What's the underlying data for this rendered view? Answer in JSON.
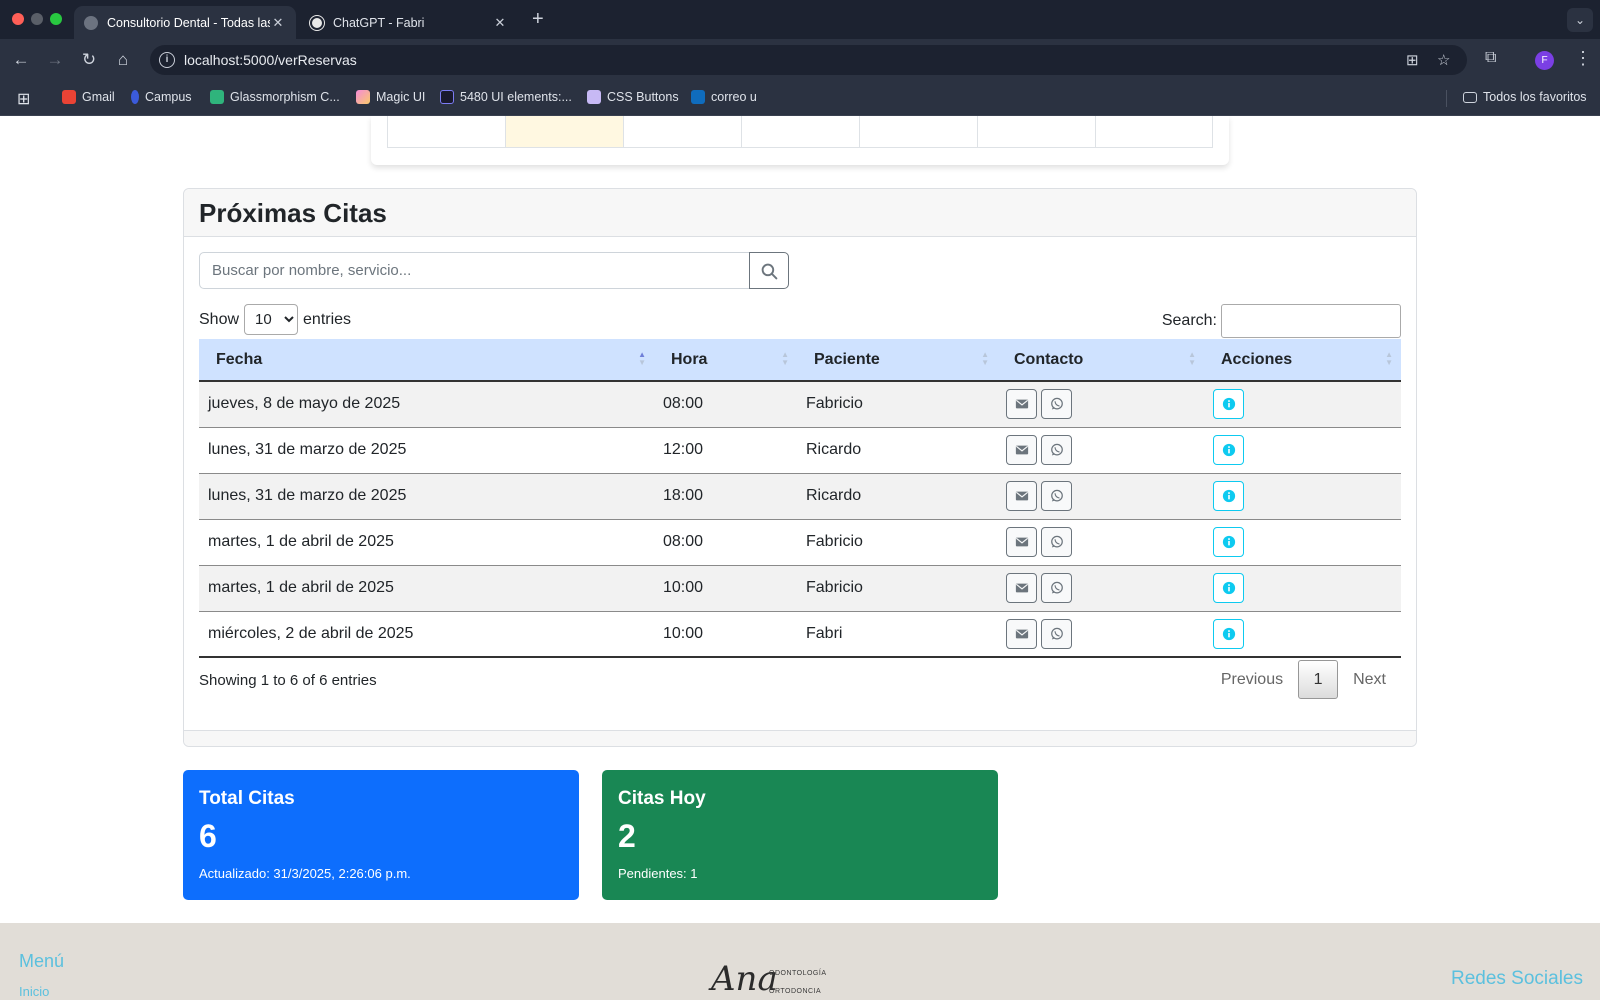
{
  "browser": {
    "tabs": [
      {
        "title": "Consultorio Dental - Todas las",
        "active": true
      },
      {
        "title": "ChatGPT - Fabri",
        "active": false
      }
    ],
    "url": "localhost:5000/verReservas",
    "avatar_letter": "F",
    "bookmarks": [
      {
        "label": "Gmail"
      },
      {
        "label": "Campus"
      },
      {
        "label": "Glassmorphism C..."
      },
      {
        "label": "Magic UI"
      },
      {
        "label": "5480 UI elements:..."
      },
      {
        "label": "CSS Buttons"
      },
      {
        "label": "correo u"
      }
    ],
    "all_bookmarks": "Todos los favoritos"
  },
  "appointments": {
    "title": "Próximas Citas",
    "search_placeholder": "Buscar por nombre, servicio...",
    "show_label": "Show",
    "entries_label": "entries",
    "page_length": "10",
    "filter_label": "Search:",
    "columns": [
      "Fecha",
      "Hora",
      "Paciente",
      "Contacto",
      "Acciones"
    ],
    "rows": [
      {
        "fecha": "jueves, 8 de mayo de 2025",
        "hora": "08:00",
        "paciente": "Fabricio"
      },
      {
        "fecha": "lunes, 31 de marzo de 2025",
        "hora": "12:00",
        "paciente": "Ricardo"
      },
      {
        "fecha": "lunes, 31 de marzo de 2025",
        "hora": "18:00",
        "paciente": "Ricardo"
      },
      {
        "fecha": "martes, 1 de abril de 2025",
        "hora": "08:00",
        "paciente": "Fabricio"
      },
      {
        "fecha": "martes, 1 de abril de 2025",
        "hora": "10:00",
        "paciente": "Fabricio"
      },
      {
        "fecha": "miércoles, 2 de abril de 2025",
        "hora": "10:00",
        "paciente": "Fabri"
      }
    ],
    "info": "Showing 1 to 6 of 6 entries",
    "pagination": {
      "previous": "Previous",
      "current": "1",
      "next": "Next"
    }
  },
  "stats": {
    "total": {
      "title": "Total Citas",
      "value": "6",
      "note": "Actualizado: 31/3/2025, 2:26:06 p.m.",
      "color": "#0d6efd"
    },
    "today": {
      "title": "Citas Hoy",
      "value": "2",
      "note": "Pendientes: 1",
      "color": "#198754"
    }
  },
  "footer": {
    "menu_title": "Menú",
    "menu_link": "Inicio",
    "logo_script": "Ana",
    "logo_line1": "ODONTOLOGÍA",
    "logo_line2": "ORTODONCIA",
    "social_title": "Redes Sociales"
  },
  "icons": {
    "search": "search-icon",
    "mail": "envelope-icon",
    "whatsapp": "whatsapp-icon",
    "info": "info-circle-icon"
  },
  "colors": {
    "header_bg": "#cfe2ff",
    "info_button": "#0dcaf0",
    "footer_accent": "#5bc0de"
  }
}
